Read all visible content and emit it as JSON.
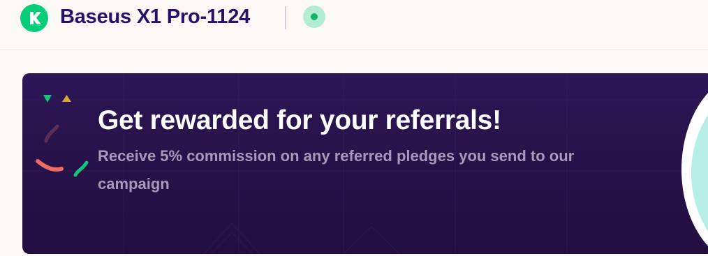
{
  "header": {
    "logo_icon": "kickstarter-k-icon",
    "title": "Baseus X1 Pro-1124",
    "status_icon": "live-status-dot-icon",
    "colors": {
      "logo": "#05ce78",
      "title": "#28106a",
      "status_ring": "#b3ecd3",
      "status_dot": "#0fb56b"
    }
  },
  "banner": {
    "heading": "Get rewarded for your referrals!",
    "subtext": "Receive 5% commission on any referred pledges you send to our campaign",
    "decoration_icon": "confetti-icon",
    "colors": {
      "background": "#261248",
      "heading": "#ffffff",
      "subtext": "#a79ab9",
      "accent_circle": "#b4eee5"
    }
  }
}
